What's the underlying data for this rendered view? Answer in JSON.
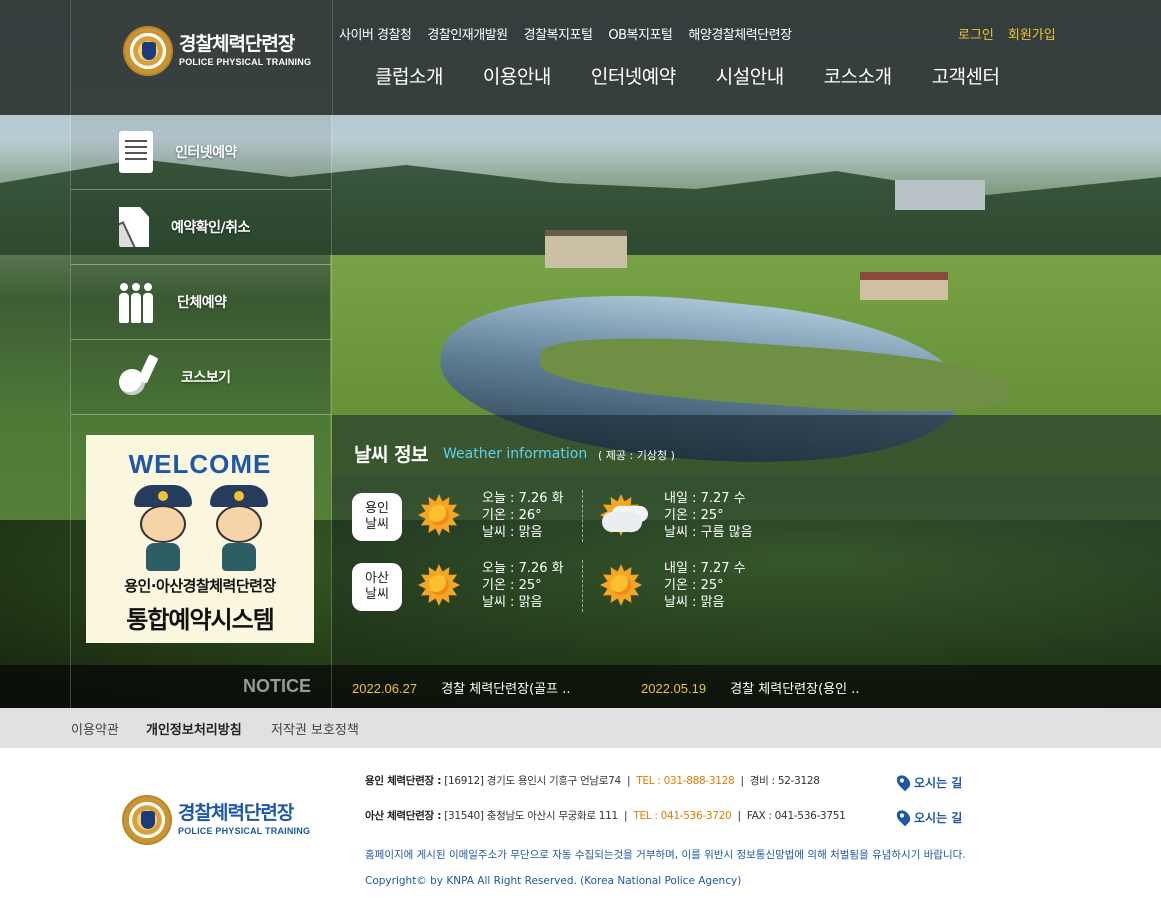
{
  "brand": {
    "name_kr": "경찰체력단련장",
    "name_en": "POLICE PHYSICAL TRAINING"
  },
  "top_links": [
    "사이버 경찰청",
    "경찰인재개발원",
    "경찰복지포털",
    "OB복지포털",
    "해양경찰체력단련장"
  ],
  "auth": {
    "login": "로그인",
    "signup": "회원가입"
  },
  "gnb": [
    "클럽소개",
    "이용안내",
    "인터넷예약",
    "시설안내",
    "코스소개",
    "고객센터"
  ],
  "quick_menu": [
    {
      "label": "인터넷예약",
      "icon": "document-list-icon"
    },
    {
      "label": "예약확인/취소",
      "icon": "document-pen-icon"
    },
    {
      "label": "단체예약",
      "icon": "group-people-icon"
    },
    {
      "label": "코스보기",
      "icon": "golf-ball-icon"
    }
  ],
  "welcome_banner": {
    "title": "WELCOME",
    "subtitle": "용인·아산경찰체력단련장",
    "main": "통합예약시스템"
  },
  "weather": {
    "title": "날씨 정보",
    "title_en": "Weather information",
    "source": "( 제공 : 기상청 )",
    "locations": [
      {
        "name_line1": "용인",
        "name_line2": "날씨",
        "today": {
          "date": "오늘 : 7.26 화",
          "temp": "기온 : 26°",
          "cond": "날씨 : 맑음",
          "icon": "sunny-icon"
        },
        "tomorrow": {
          "date": "내일 : 7.27 수",
          "temp": "기온 : 25°",
          "cond": "날씨 : 구름 많음",
          "icon": "cloudy-icon"
        }
      },
      {
        "name_line1": "아산",
        "name_line2": "날씨",
        "today": {
          "date": "오늘 : 7.26 화",
          "temp": "기온 : 25°",
          "cond": "날씨 : 맑음",
          "icon": "sunny-icon"
        },
        "tomorrow": {
          "date": "내일 : 7.27 수",
          "temp": "기온 : 25°",
          "cond": "날씨 : 맑음",
          "icon": "sunny-icon"
        }
      }
    ]
  },
  "notice": {
    "label": "NOTICE",
    "items": [
      {
        "date": "2022.06.27",
        "title": "경찰 체력단련장(골프 .."
      },
      {
        "date": "2022.05.19",
        "title": "경찰 체력단련장(용인 .."
      }
    ]
  },
  "footer_links": [
    "이용약관",
    "개인정보처리방침",
    "저작권 보호정책"
  ],
  "footer": {
    "yongin": {
      "name": "용인 체력단련장 :",
      "address": "[16912] 경기도 용인시 기흥구 언남로74",
      "tel": "TEL : 031-888-3128",
      "extra": "경비 : 52-3128"
    },
    "asan": {
      "name": "아산 체력단련장 :",
      "address": "[31540] 충청남도 아산시 무궁화로 111",
      "tel": "TEL : 041-536-3720",
      "extra": "FAX : 041-536-3751"
    },
    "map_link": "오시는 길",
    "notice_text": "홈페이지에 게시된 이메일주소가 무단으로 자동 수집되는것을 거부하며, 이를 위반시 정보통신망법에 의해 처벌됨을 유념하시기 바랍니다.",
    "copyright": "Copyright© by KNPA All Right Reserved. (Korea National Police Agency)"
  }
}
